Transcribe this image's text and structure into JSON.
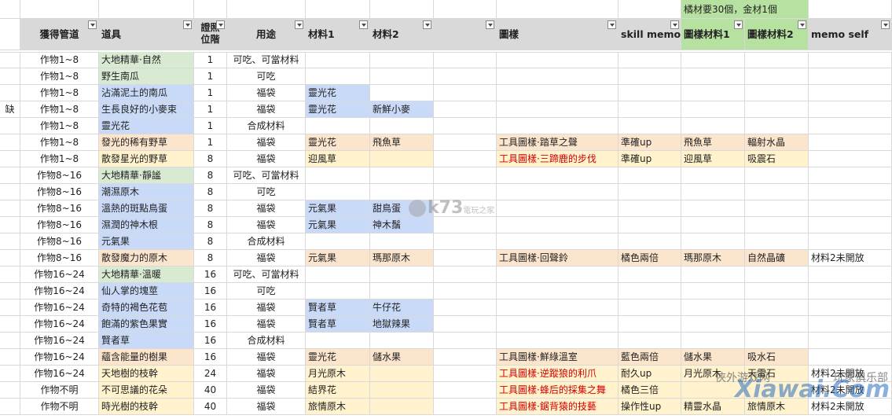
{
  "sheet": {
    "top_note": "橘材要30個，金材1個",
    "headers": {
      "gain": "獲得管道",
      "item": "道具",
      "tier": "證照位階",
      "usage": "用途",
      "mat1": "材料1",
      "mat2": "材料2",
      "blank": "",
      "pattern": "圖樣",
      "skill": "skill memo",
      "pmat1": "圖樣材料1",
      "pmat2": "圖樣材料2",
      "memo": "memo self"
    },
    "rows": [
      {
        "mark": "",
        "gain": "作物1~8",
        "item": "大地精華·自然",
        "tier": "1",
        "usage": "可吃、可當材料",
        "mat1": "",
        "mat2": "",
        "pattern": "",
        "skill": "",
        "pmat1": "",
        "pmat2": "",
        "memo": ""
      },
      {
        "mark": "",
        "gain": "作物1~8",
        "item": "野生南瓜",
        "tier": "1",
        "usage": "可吃",
        "mat1": "",
        "mat2": "",
        "pattern": "",
        "skill": "",
        "pmat1": "",
        "pmat2": "",
        "memo": ""
      },
      {
        "mark": "",
        "gain": "作物1~8",
        "item": "沾滿泥土的南瓜",
        "tier": "1",
        "usage": "福袋",
        "mat1": "靈光花",
        "mat2": "",
        "pattern": "",
        "skill": "",
        "pmat1": "",
        "pmat2": "",
        "memo": ""
      },
      {
        "mark": "缺",
        "gain": "作物1~8",
        "item": "生長良好的小麥束",
        "tier": "1",
        "usage": "福袋",
        "mat1": "靈光花",
        "mat2": "新鮮小麥",
        "pattern": "",
        "skill": "",
        "pmat1": "",
        "pmat2": "",
        "memo": ""
      },
      {
        "mark": "",
        "gain": "作物1~8",
        "item": "靈光花",
        "tier": "1",
        "usage": "合成材料",
        "mat1": "",
        "mat2": "",
        "pattern": "",
        "skill": "",
        "pmat1": "",
        "pmat2": "",
        "memo": ""
      },
      {
        "mark": "",
        "gain": "作物1~8",
        "item": "發光的稀有野草",
        "tier": "1",
        "usage": "福袋",
        "mat1": "靈光花",
        "mat2": "飛魚草",
        "pattern": "工具圖樣·踏草之聲",
        "skill": "準確up",
        "pmat1": "飛魚草",
        "pmat2": "輻射水晶",
        "memo": ""
      },
      {
        "mark": "",
        "gain": "作物1~8",
        "item": "散發星光的野草",
        "tier": "8",
        "usage": "福袋",
        "mat1": "迎風草",
        "mat2": "",
        "pattern": "工具圖樣·三蹄鹿的步伐",
        "skill": "準確up",
        "pmat1": "迎風草",
        "pmat2": "吸震石",
        "memo": ""
      },
      {
        "mark": "",
        "gain": "作物8~16",
        "item": "大地精華·靜謐",
        "tier": "8",
        "usage": "可吃、可當材料",
        "mat1": "",
        "mat2": "",
        "pattern": "",
        "skill": "",
        "pmat1": "",
        "pmat2": "",
        "memo": ""
      },
      {
        "mark": "",
        "gain": "作物8~16",
        "item": "潮濕原木",
        "tier": "8",
        "usage": "可吃",
        "mat1": "",
        "mat2": "",
        "pattern": "",
        "skill": "",
        "pmat1": "",
        "pmat2": "",
        "memo": ""
      },
      {
        "mark": "",
        "gain": "作物8~16",
        "item": "溫熱的斑點鳥蛋",
        "tier": "8",
        "usage": "福袋",
        "mat1": "元氣果",
        "mat2": "甜鳥蛋",
        "pattern": "",
        "skill": "",
        "pmat1": "",
        "pmat2": "",
        "memo": ""
      },
      {
        "mark": "",
        "gain": "作物8~16",
        "item": "濕潤的神木根",
        "tier": "8",
        "usage": "福袋",
        "mat1": "元氣果",
        "mat2": "神木鬚",
        "pattern": "",
        "skill": "",
        "pmat1": "",
        "pmat2": "",
        "memo": ""
      },
      {
        "mark": "",
        "gain": "作物8~16",
        "item": "元氣果",
        "tier": "8",
        "usage": "合成材料",
        "mat1": "",
        "mat2": "",
        "pattern": "",
        "skill": "",
        "pmat1": "",
        "pmat2": "",
        "memo": ""
      },
      {
        "mark": "",
        "gain": "作物8~16",
        "item": "散發魔力的原木",
        "tier": "8",
        "usage": "福袋",
        "mat1": "元氣果",
        "mat2": "瑪那原木",
        "pattern": "工具圖樣·回聲鈴",
        "skill": "橘色兩倍",
        "pmat1": "瑪那原木",
        "pmat2": "自然晶礦",
        "memo": "材料2未開放"
      },
      {
        "mark": "",
        "gain": "作物16~24",
        "item": "大地精華·溫暖",
        "tier": "16",
        "usage": "可吃、可當材料",
        "mat1": "",
        "mat2": "",
        "pattern": "",
        "skill": "",
        "pmat1": "",
        "pmat2": "",
        "memo": ""
      },
      {
        "mark": "",
        "gain": "作物16~24",
        "item": "仙人掌的塊莖",
        "tier": "16",
        "usage": "可吃",
        "mat1": "",
        "mat2": "",
        "pattern": "",
        "skill": "",
        "pmat1": "",
        "pmat2": "",
        "memo": ""
      },
      {
        "mark": "",
        "gain": "作物16~24",
        "item": "奇特的褐色花苞",
        "tier": "16",
        "usage": "福袋",
        "mat1": "賢者草",
        "mat2": "牛仔花",
        "pattern": "",
        "skill": "",
        "pmat1": "",
        "pmat2": "",
        "memo": ""
      },
      {
        "mark": "",
        "gain": "作物16~24",
        "item": "飽滿的紫色果實",
        "tier": "16",
        "usage": "福袋",
        "mat1": "賢者草",
        "mat2": "地獄辣果",
        "pattern": "",
        "skill": "",
        "pmat1": "",
        "pmat2": "",
        "memo": ""
      },
      {
        "mark": "",
        "gain": "作物16~24",
        "item": "賢者草",
        "tier": "16",
        "usage": "合成材料",
        "mat1": "",
        "mat2": "",
        "pattern": "",
        "skill": "",
        "pmat1": "",
        "pmat2": "",
        "memo": ""
      },
      {
        "mark": "",
        "gain": "作物16~24",
        "item": "蘊含能量的樹果",
        "tier": "16",
        "usage": "福袋",
        "mat1": "靈光花",
        "mat2": "儲水果",
        "pattern": "工具圖樣·鮮綠溫室",
        "skill": "藍色兩倍",
        "pmat1": "儲水果",
        "pmat2": "吸水石",
        "memo": ""
      },
      {
        "mark": "",
        "gain": "作物16~24",
        "item": "天地樹的枝幹",
        "tier": "24",
        "usage": "福袋",
        "mat1": "月光原木",
        "mat2": "",
        "pattern": "工具圖樣·逆蹤狼的利爪",
        "skill": "耐久up",
        "pmat1": "月光原木",
        "pmat2": "天雷石",
        "memo": "材料2未開放"
      },
      {
        "mark": "",
        "gain": "作物不明",
        "item": "不可思議的花朵",
        "tier": "40",
        "usage": "福袋",
        "mat1": "結界花",
        "mat2": "",
        "pattern": "工具圖樣·蜂后的採集之舞",
        "skill": "橘色三倍",
        "pmat1": "",
        "pmat2": "",
        "memo": "材料2未開放"
      },
      {
        "mark": "",
        "gain": "作物不明",
        "item": "時光樹的枝幹",
        "tier": "40",
        "usage": "福袋",
        "mat1": "旅情原木",
        "mat2": "",
        "pattern": "工具圖樣·鋸背猿的技藝",
        "skill": "操作性up",
        "pmat1": "精靈水晶",
        "pmat2": "旅情原木",
        "memo": "材料2未開放"
      }
    ],
    "item_colors": [
      "green",
      "green",
      "blue",
      "blue",
      "blue",
      "orange",
      "yellow",
      "green",
      "blue",
      "blue",
      "blue",
      "blue",
      "orange",
      "green",
      "blue",
      "blue",
      "blue",
      "blue",
      "orange",
      "yellow",
      "yellow",
      "yellow"
    ],
    "mat_colors": [
      [
        "",
        ""
      ],
      [
        "",
        ""
      ],
      [
        "blue",
        ""
      ],
      [
        "blue",
        "blue"
      ],
      [
        "",
        ""
      ],
      [
        "orange",
        "orange"
      ],
      [
        "yellow",
        "yellow"
      ],
      [
        "",
        ""
      ],
      [
        "",
        ""
      ],
      [
        "blue",
        "blue"
      ],
      [
        "blue",
        "blue"
      ],
      [
        "",
        ""
      ],
      [
        "orange",
        "orange"
      ],
      [
        "",
        ""
      ],
      [
        "",
        ""
      ],
      [
        "blue",
        "blue"
      ],
      [
        "blue",
        "blue"
      ],
      [
        "",
        ""
      ],
      [
        "orange",
        "orange"
      ],
      [
        "yellow",
        "yellow"
      ],
      [
        "yellow",
        "yellow"
      ],
      [
        "yellow",
        "yellow"
      ]
    ],
    "pattern_red": [
      false,
      false,
      false,
      false,
      false,
      false,
      true,
      false,
      false,
      false,
      false,
      false,
      false,
      false,
      false,
      false,
      false,
      false,
      false,
      true,
      true,
      true
    ],
    "pattern_colors": [
      "",
      "",
      "",
      "",
      "",
      "orange",
      "yellow",
      "",
      "",
      "",
      "",
      "",
      "orange",
      "",
      "",
      "",
      "",
      "",
      "orange",
      "yellow",
      "yellow",
      "yellow"
    ]
  },
  "watermarks": {
    "k73": "k73",
    "k73_sub": "電玩之家",
    "xiawai": "Xiawai.Com",
    "xiawai_left": "俠外游戏网",
    "xiawai_right": "玩家俱乐部"
  },
  "colors": {
    "green": "#d9ead3",
    "blue": "#c9daf8",
    "orange": "#fce5cd",
    "yellow": "#fff2cc",
    "header_gray": "#d9d9d9",
    "header_green": "#b7e1a1",
    "red_text": "#d00000"
  }
}
